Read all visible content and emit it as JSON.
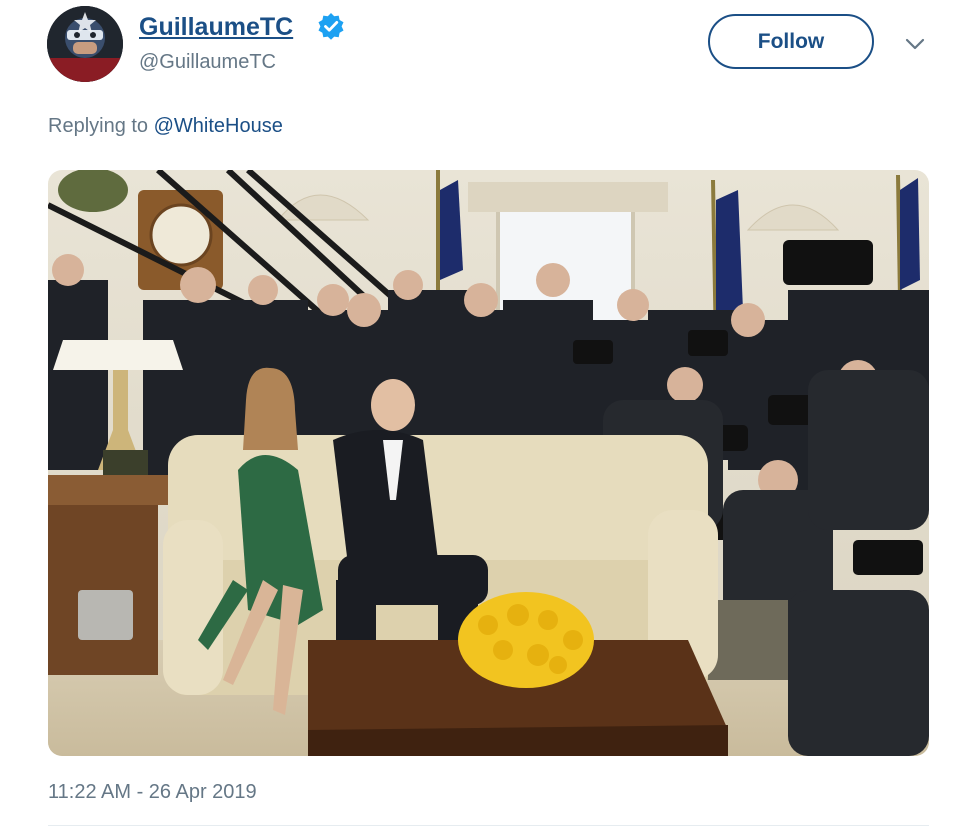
{
  "tweet": {
    "display_name": "GuillaumeTC",
    "handle": "@GuillaumeTC",
    "verified_icon": "verified-badge-icon",
    "follow_label": "Follow",
    "menu_icon": "chevron-down-icon",
    "reply_prefix": "Replying to",
    "reply_mention": "@WhiteHouse",
    "timestamp": "11:22 AM - 26 Apr 2019"
  },
  "photo": {
    "subject": "Oval Office meeting photograph with press photographers"
  },
  "colors": {
    "link": "#1b4f86",
    "verified": "#1da1f2",
    "muted": "#657786",
    "divider": "#e6ecf0"
  }
}
